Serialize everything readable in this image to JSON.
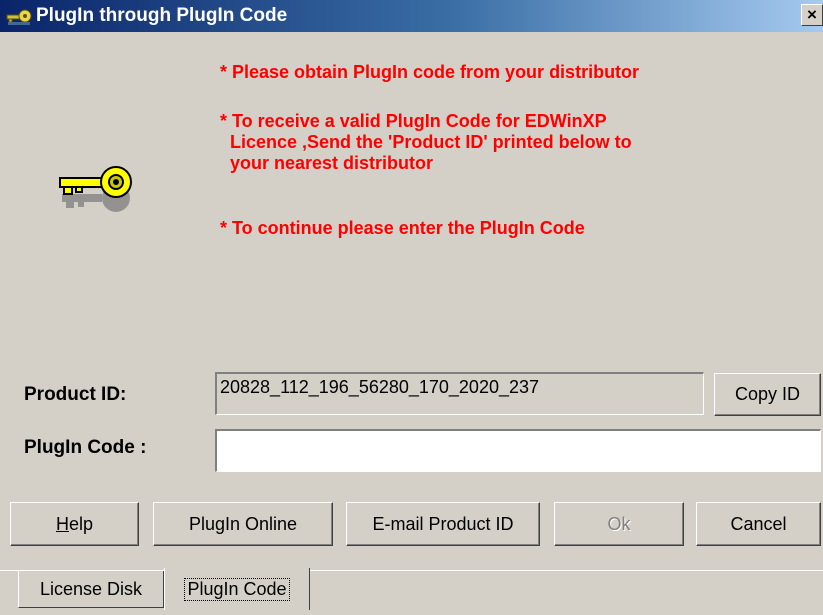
{
  "window": {
    "title": "PlugIn through PlugIn Code",
    "close_glyph": "×"
  },
  "messages": [
    "* Please obtain PlugIn code from your distributor",
    "* To receive a valid PlugIn Code for EDWinXP\n  Licence ,Send the 'Product ID' printed below to\n  your nearest distributor",
    "* To continue please enter the PlugIn Code"
  ],
  "form": {
    "product_id_label": "Product ID:",
    "product_id_value": "20828_112_196_56280_170_2020_237",
    "copy_id_label": "Copy ID",
    "plugin_code_label": "PlugIn Code :",
    "plugin_code_value": ""
  },
  "buttons": {
    "help": {
      "mnemonic": "H",
      "rest": "elp"
    },
    "plugin_online": "PlugIn Online",
    "email_product_id": "E-mail Product ID",
    "ok": "Ok",
    "cancel": "Cancel"
  },
  "tabs": [
    {
      "label": "License Disk",
      "active": false
    },
    {
      "label": "PlugIn Code",
      "active": true
    }
  ],
  "icons": {
    "title": "key-icon",
    "main": "key-icon"
  },
  "colors": {
    "message_text": "#ff0000",
    "titlebar_start": "#0a246a",
    "titlebar_end": "#a6caf0",
    "dialog_bg": "#d4d0c8"
  }
}
